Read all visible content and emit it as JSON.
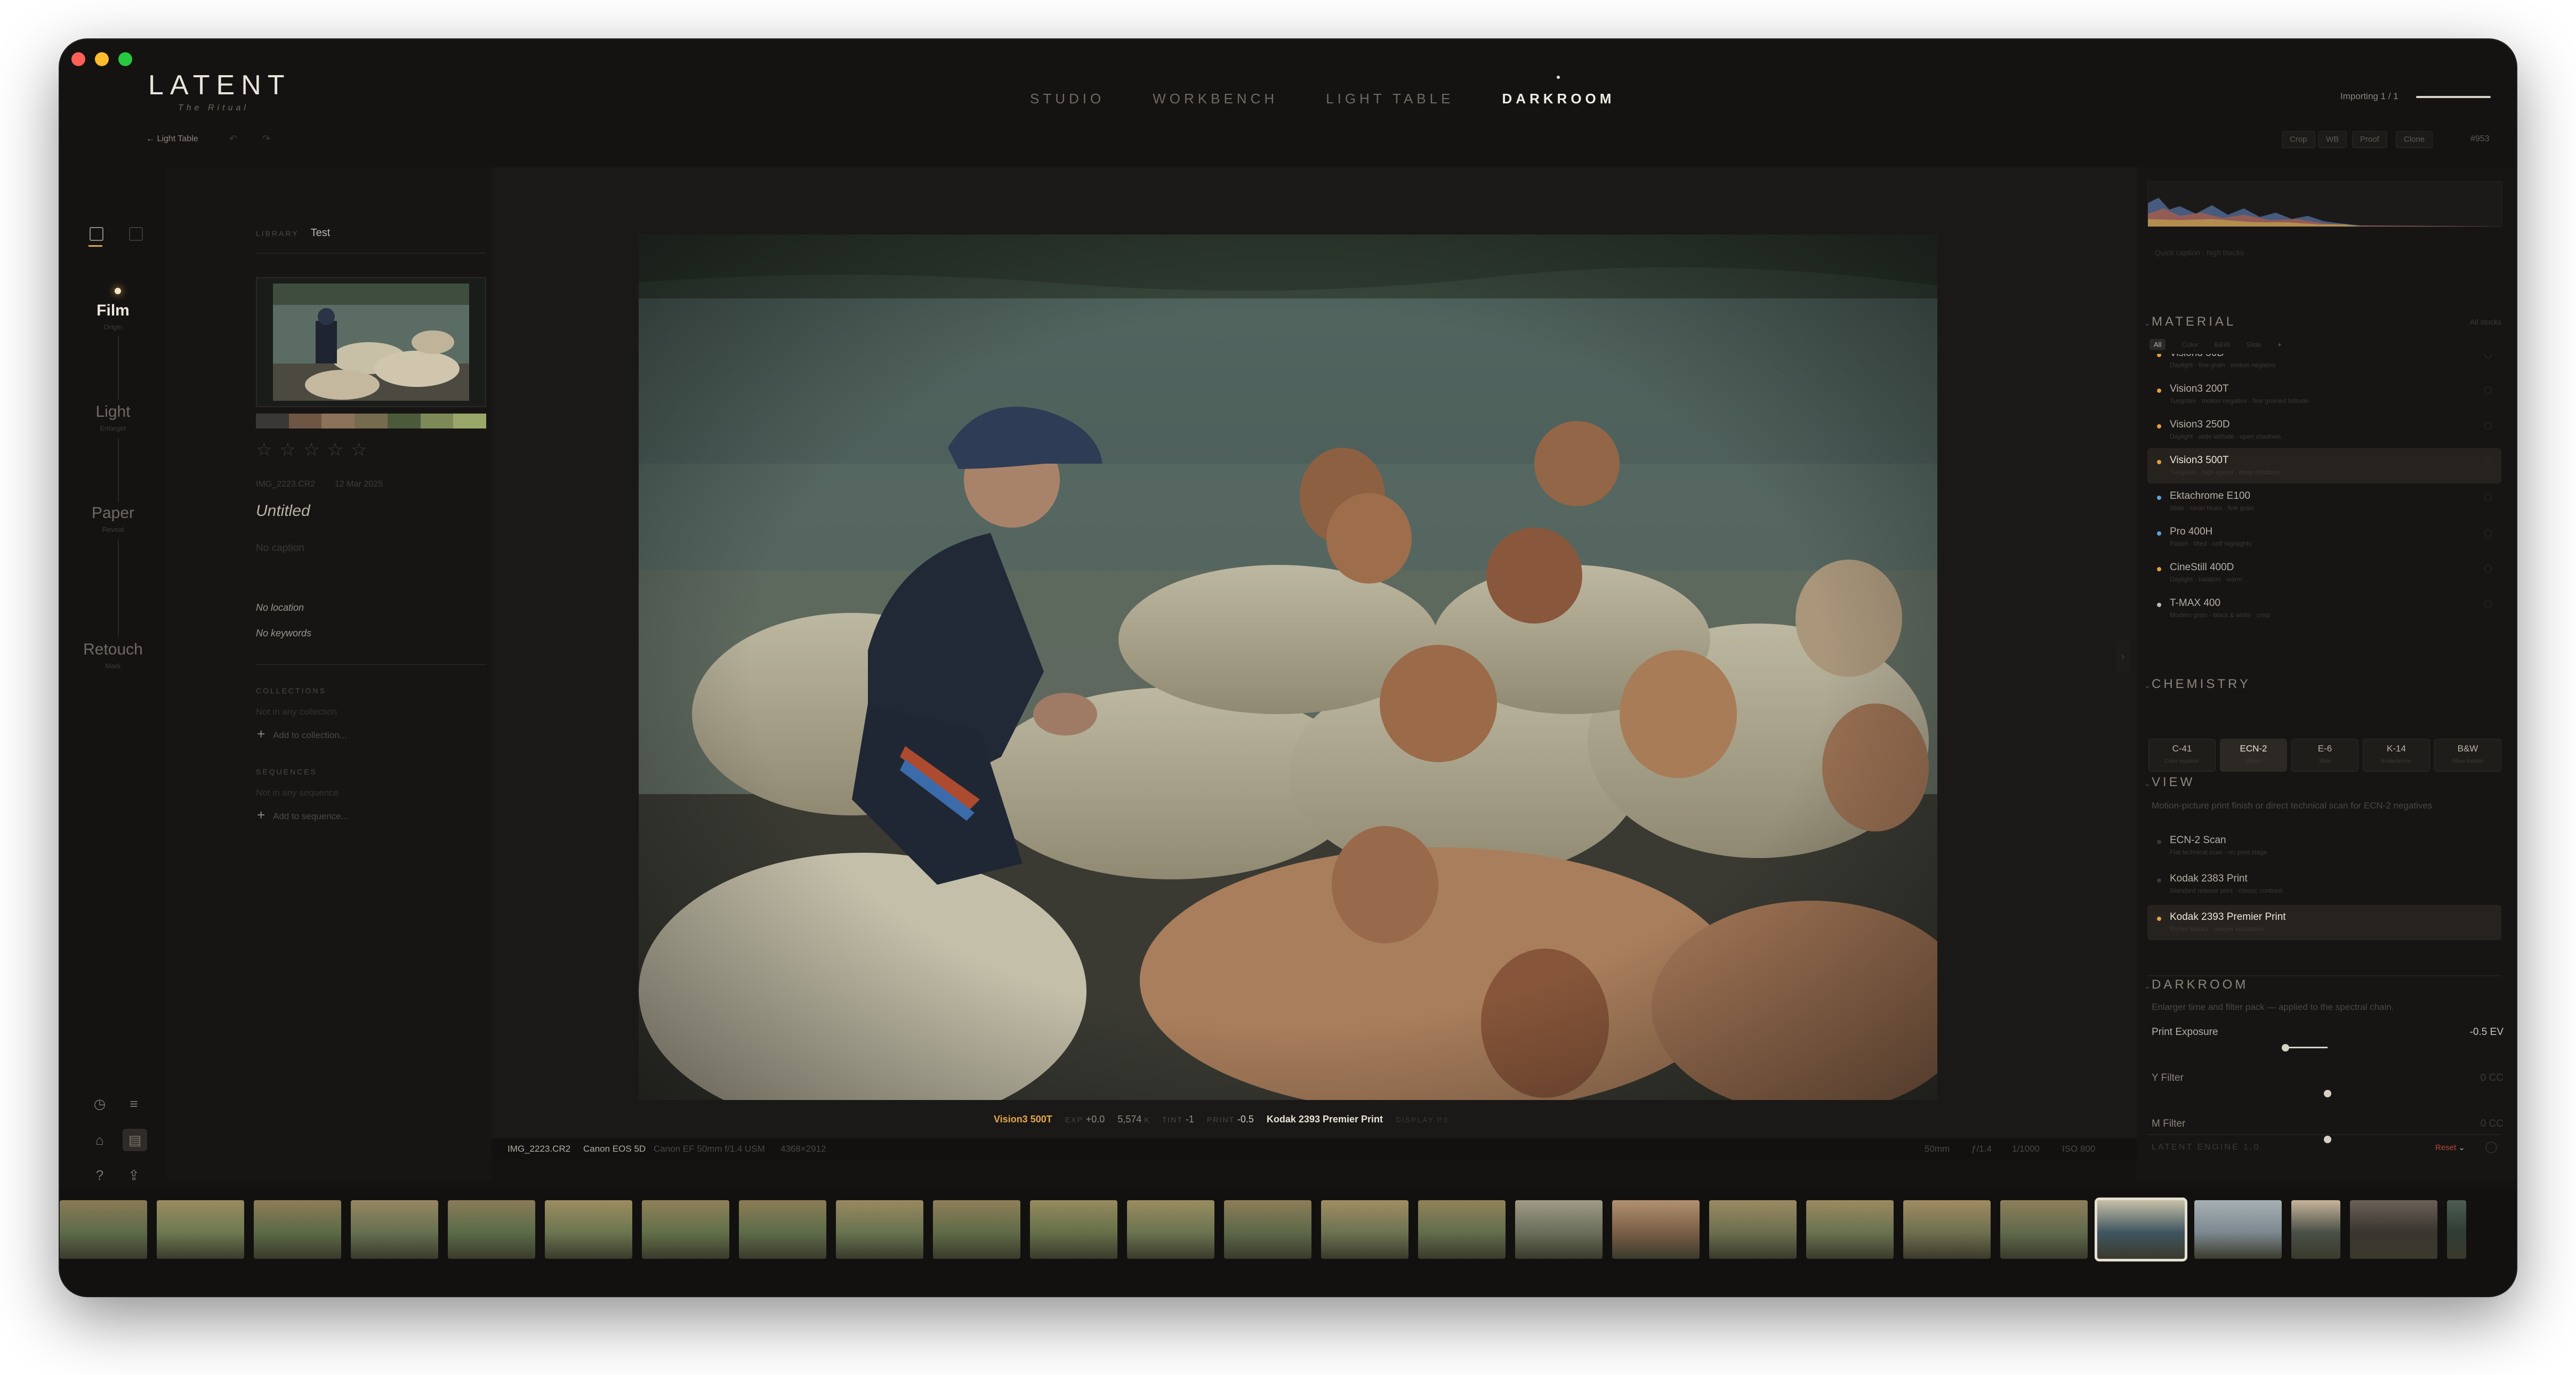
{
  "app": {
    "name": "LATENT",
    "subtitle": "The Ritual"
  },
  "nav": {
    "tabs": [
      "STUDIO",
      "WORKBENCH",
      "LIGHT TABLE",
      "DARKROOM"
    ],
    "active": "DARKROOM"
  },
  "import_status": "Importing 1 / 1",
  "back_link": "← Light Table",
  "header_buttons": [
    "Crop",
    "WB",
    "Proof",
    "Clone"
  ],
  "image_counter": "#953",
  "stages": [
    {
      "name": "Film",
      "sub": "Origin",
      "active": true
    },
    {
      "name": "Light",
      "sub": "Enlarger",
      "active": false
    },
    {
      "name": "Paper",
      "sub": "Reveal",
      "active": false
    },
    {
      "name": "Retouch",
      "sub": "Mark",
      "active": false
    }
  ],
  "library": {
    "label": "LIBRARY",
    "name": "Test",
    "filename": "IMG_2223.CR2",
    "date": "12 Mar 2025",
    "title": "Untitled",
    "caption": "No caption",
    "location": "No location",
    "keywords": "No keywords",
    "collections_label": "COLLECTIONS",
    "collections_empty": "Not in any collection",
    "add_collection": "Add to collection...",
    "sequences_label": "SEQUENCES",
    "sequences_empty": "Not in any sequence",
    "add_sequence": "Add to sequence..."
  },
  "palette": [
    "#3a3836",
    "#6e5544",
    "#8c7258",
    "#766b4e",
    "#4c5a3c",
    "#7d8a58",
    "#9aa76a"
  ],
  "caption_bar": {
    "film": "Vision3 500T",
    "exp_label": "EXP",
    "exp": "+0.0",
    "kelvin": "5,574",
    "kelvin_unit": "K",
    "tint_label": "TINT",
    "tint": "-1",
    "print_label": "PRINT",
    "print": "-0.5",
    "paper": "Kodak 2393 Premier Print",
    "display": "DISPLAY P3"
  },
  "info_bar": {
    "file": "IMG_2223.CR2",
    "camera": "Canon EOS 5D",
    "lens": "Canon EF 50mm f/1.4 USM",
    "dims": "4368×2912",
    "focal": "50mm",
    "aperture": "ƒ/1.4",
    "shutter": "1/1000",
    "iso": "ISO 800"
  },
  "right": {
    "histogram_caption": "Quick caption · high blacks",
    "material": {
      "title": "MATERIAL",
      "count": "All stocks",
      "filters": [
        "All",
        "Color",
        "B&W",
        "Slide",
        "+"
      ],
      "stocks": [
        {
          "name": "Vision3 50D",
          "sub": "Daylight · fine grain · motion negative",
          "color": "#e0a040"
        },
        {
          "name": "Vision3 200T",
          "sub": "Tungsten · motion negative · fine grained latitude",
          "color": "#e0a040"
        },
        {
          "name": "Vision3 250D",
          "sub": "Daylight · wide latitude · open shadows",
          "color": "#e0a040"
        },
        {
          "name": "Vision3 500T",
          "sub": "Tungsten · high speed · deep shadows",
          "color": "#e0a040",
          "selected": true
        },
        {
          "name": "Ektachrome E100",
          "sub": "Slide · clean blues · fine grain",
          "color": "#5fa2d6"
        },
        {
          "name": "Pro 400H",
          "sub": "Pastel · lifted · soft highlights",
          "color": "#5fa2d6"
        },
        {
          "name": "CineStill 400D",
          "sub": "Daylight · halation · warm",
          "color": "#e0a040"
        },
        {
          "name": "T-MAX 400",
          "sub": "Modern grain · black & white · crisp",
          "color": "#bbbbbb"
        }
      ]
    },
    "chemistry": {
      "title": "CHEMISTRY",
      "processes": [
        {
          "name": "C-41",
          "sub": "Color negative"
        },
        {
          "name": "ECN-2",
          "sub": "Motion",
          "selected": true
        },
        {
          "name": "E-6",
          "sub": "Slide"
        },
        {
          "name": "K-14",
          "sub": "Kodachrome"
        },
        {
          "name": "B&W",
          "sub": "Silver Gelatin"
        }
      ]
    },
    "view": {
      "title": "VIEW",
      "desc": "Motion-picture print finish or direct technical scan for ECN-2 negatives",
      "items": [
        {
          "name": "ECN-2 Scan",
          "sub": "Flat technical scan · no print stage"
        },
        {
          "name": "Kodak 2383 Print",
          "sub": "Standard release print · classic contrast"
        },
        {
          "name": "Kodak 2393 Premier Print",
          "sub": "Richer blacks · deeper saturation",
          "selected": true
        }
      ]
    },
    "darkroom": {
      "title": "DARKROOM",
      "desc": "Enlarger time and filter pack — applied to the spectral chain.",
      "sliders": [
        {
          "label": "Print Exposure",
          "value": "-0.5",
          "unit": "EV",
          "position": 0.38,
          "active": true
        },
        {
          "label": "Y Filter",
          "value": "0",
          "unit": "CC",
          "position": 0.5,
          "active": false
        },
        {
          "label": "M Filter",
          "value": "0",
          "unit": "CC",
          "position": 0.5,
          "active": false
        }
      ]
    },
    "engine": "LATENT ENGINE 1.0",
    "reset": "Reset"
  },
  "filmstrip_selected": 21
}
